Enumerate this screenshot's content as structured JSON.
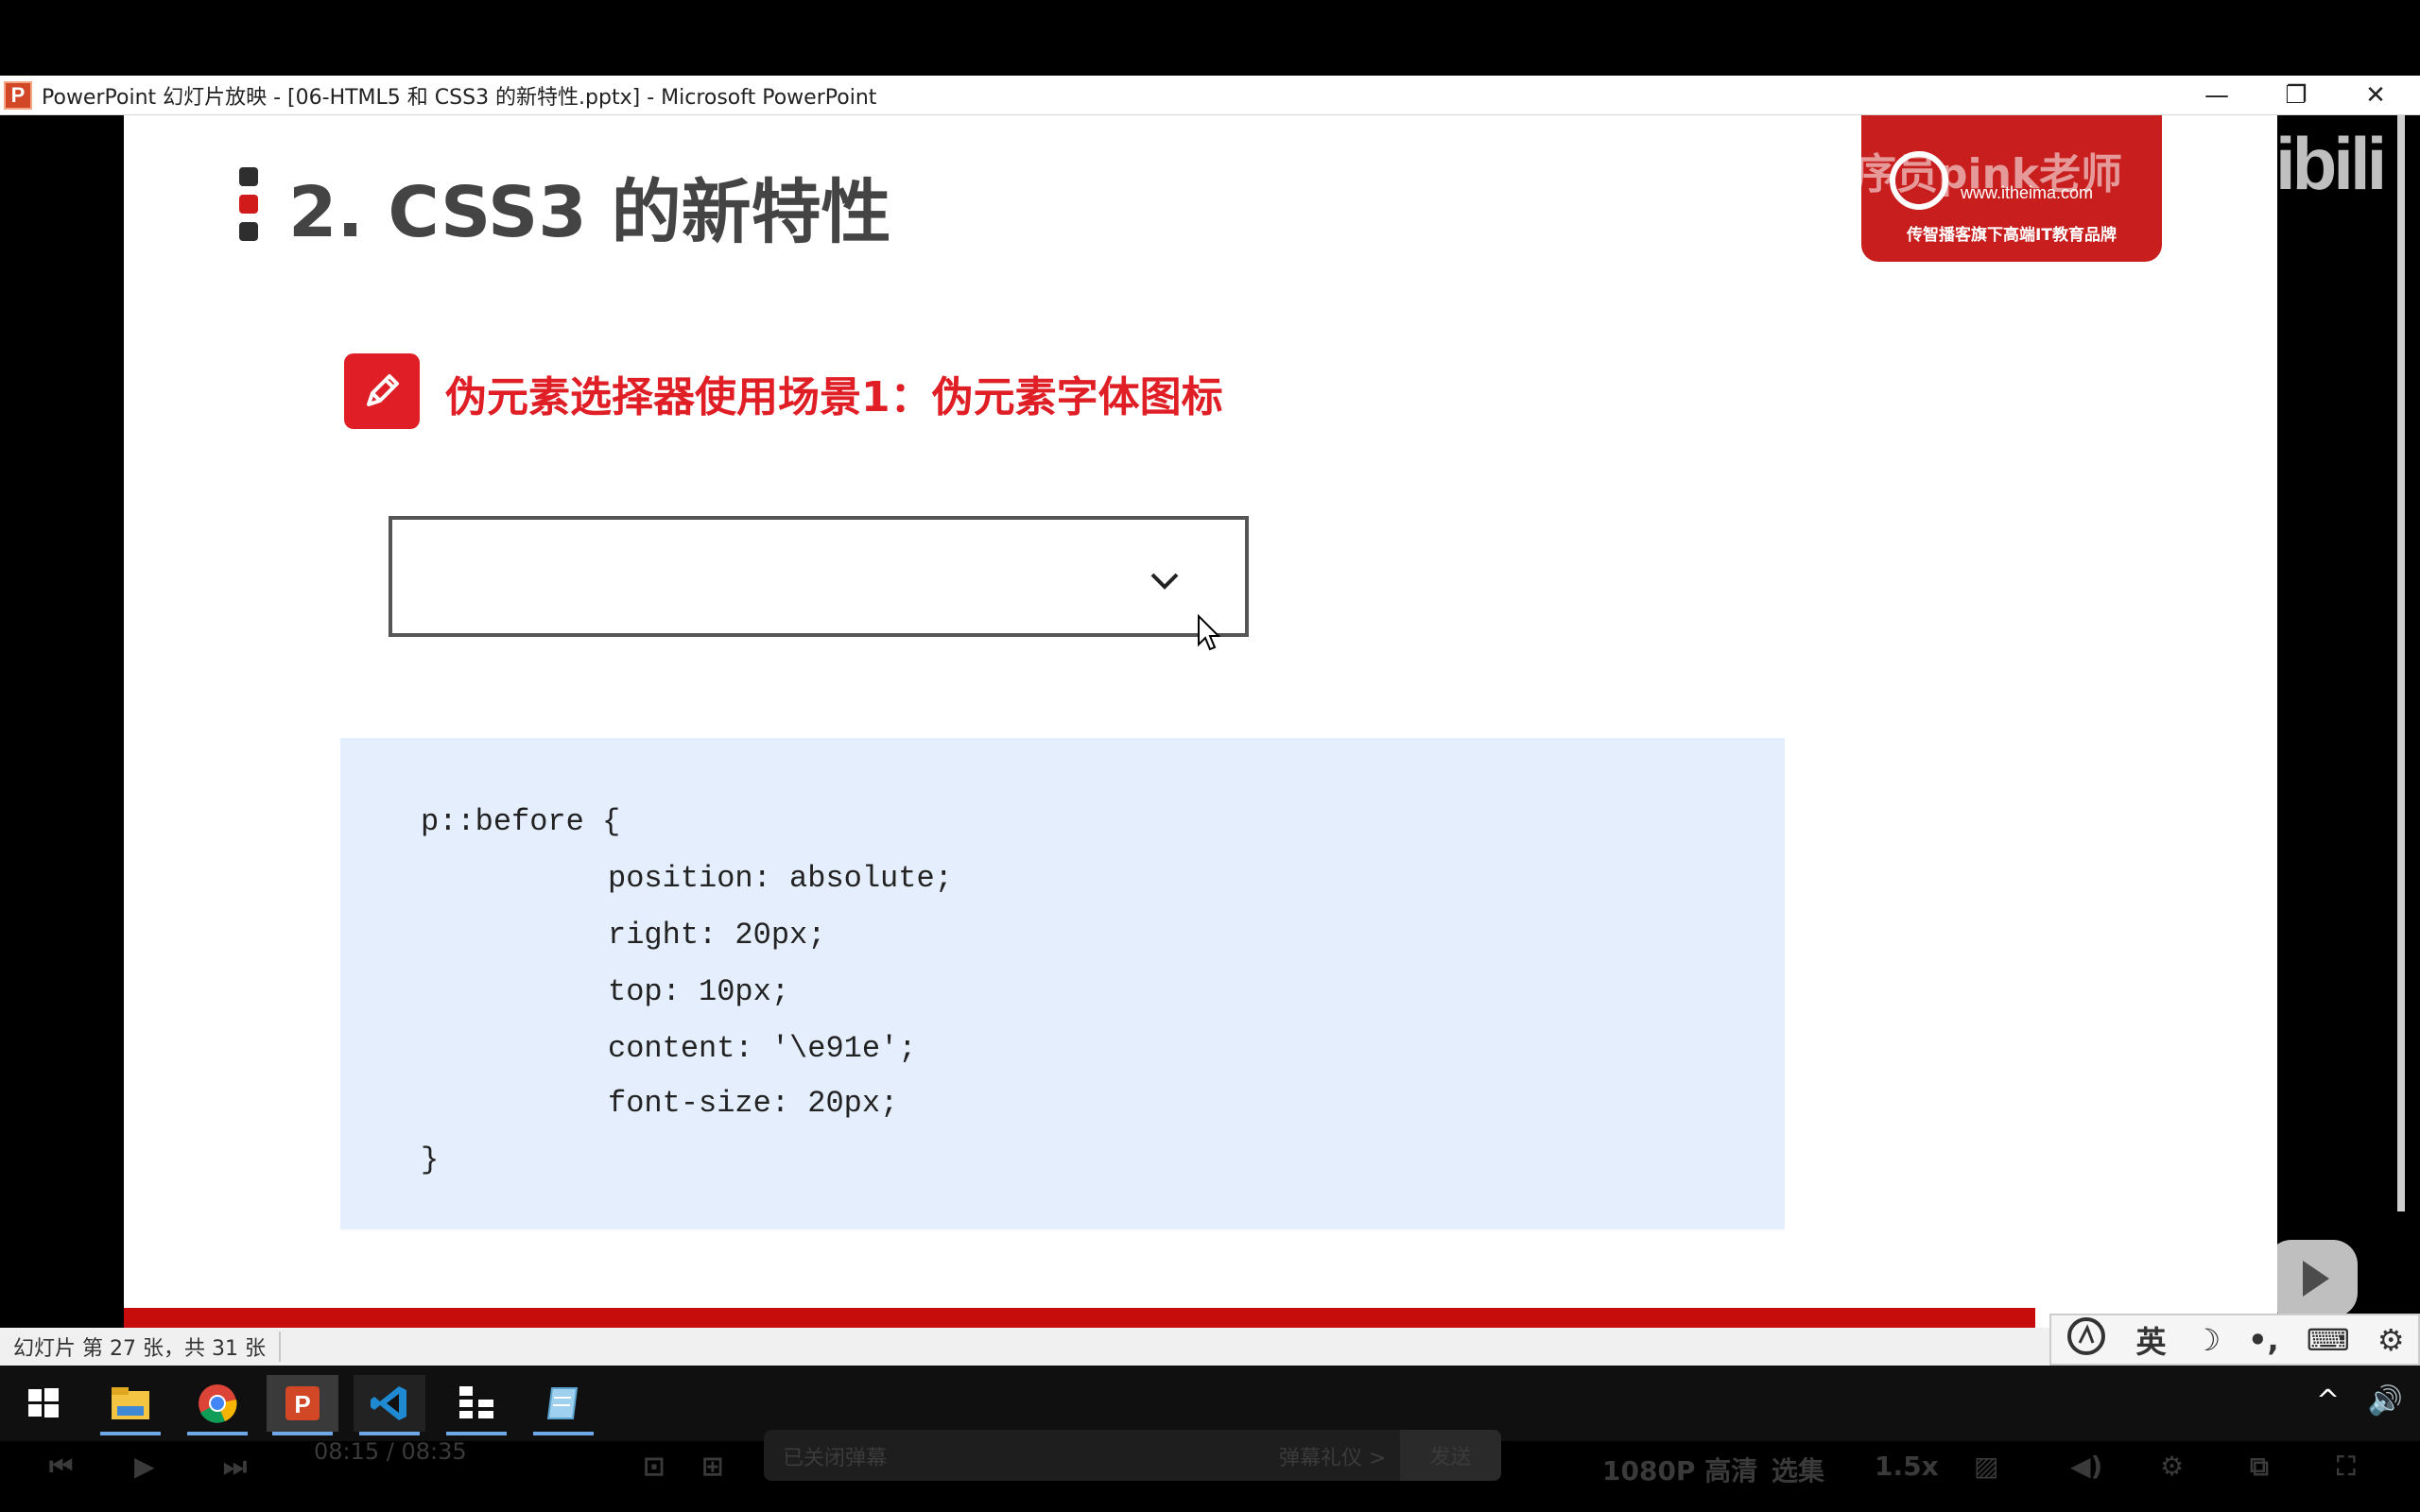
{
  "window": {
    "app_icon_letter": "P",
    "title": "PowerPoint 幻灯片放映 - [06-HTML5 和 CSS3 的新特性.pptx] - Microsoft PowerPoint",
    "minimize_glyph": "—",
    "restore_glyph": "❐",
    "close_glyph": "✕"
  },
  "slide": {
    "title": "2. CSS3 的新特性",
    "section_heading": "伪元素选择器使用场景1：伪元素字体图标",
    "logo": {
      "url": "www.itheima.com",
      "slogan": "传智播客旗下高端IT教育品牌"
    },
    "code_lines": [
      "p::before {",
      "position: absolute;",
      "right: 20px;",
      "top: 10px;",
      "content: '\\e91e';",
      "font-size: 20px;",
      "}"
    ]
  },
  "watermark": {
    "text": "黑马程序员pink老师",
    "bili": "bilibili"
  },
  "statusbar": {
    "slide_counter": "幻灯片 第 27 张，共 31 张"
  },
  "ime": {
    "lang": "英",
    "moon": "☽",
    "punct": "•,",
    "keyboard": "⌨",
    "gear": "⚙"
  },
  "taskbar": {
    "items": [
      "windows-start",
      "file-explorer",
      "chrome",
      "powerpoint",
      "vscode",
      "app-tool",
      "notepad"
    ]
  },
  "tray": {
    "chevron": "^",
    "volume": "🔊"
  },
  "player": {
    "time": "08:15 / 08:35",
    "danmaku_placeholder": "已关闭弹幕",
    "danmaku_etiquette": "弹幕礼仪 >",
    "send": "发送",
    "quality": "1080P 高清",
    "episodes": "选集",
    "speed": "1.5x"
  },
  "colors": {
    "brand_red": "#e01e26",
    "code_bg": "#e4eefc",
    "red_bar": "#c70c0c"
  }
}
